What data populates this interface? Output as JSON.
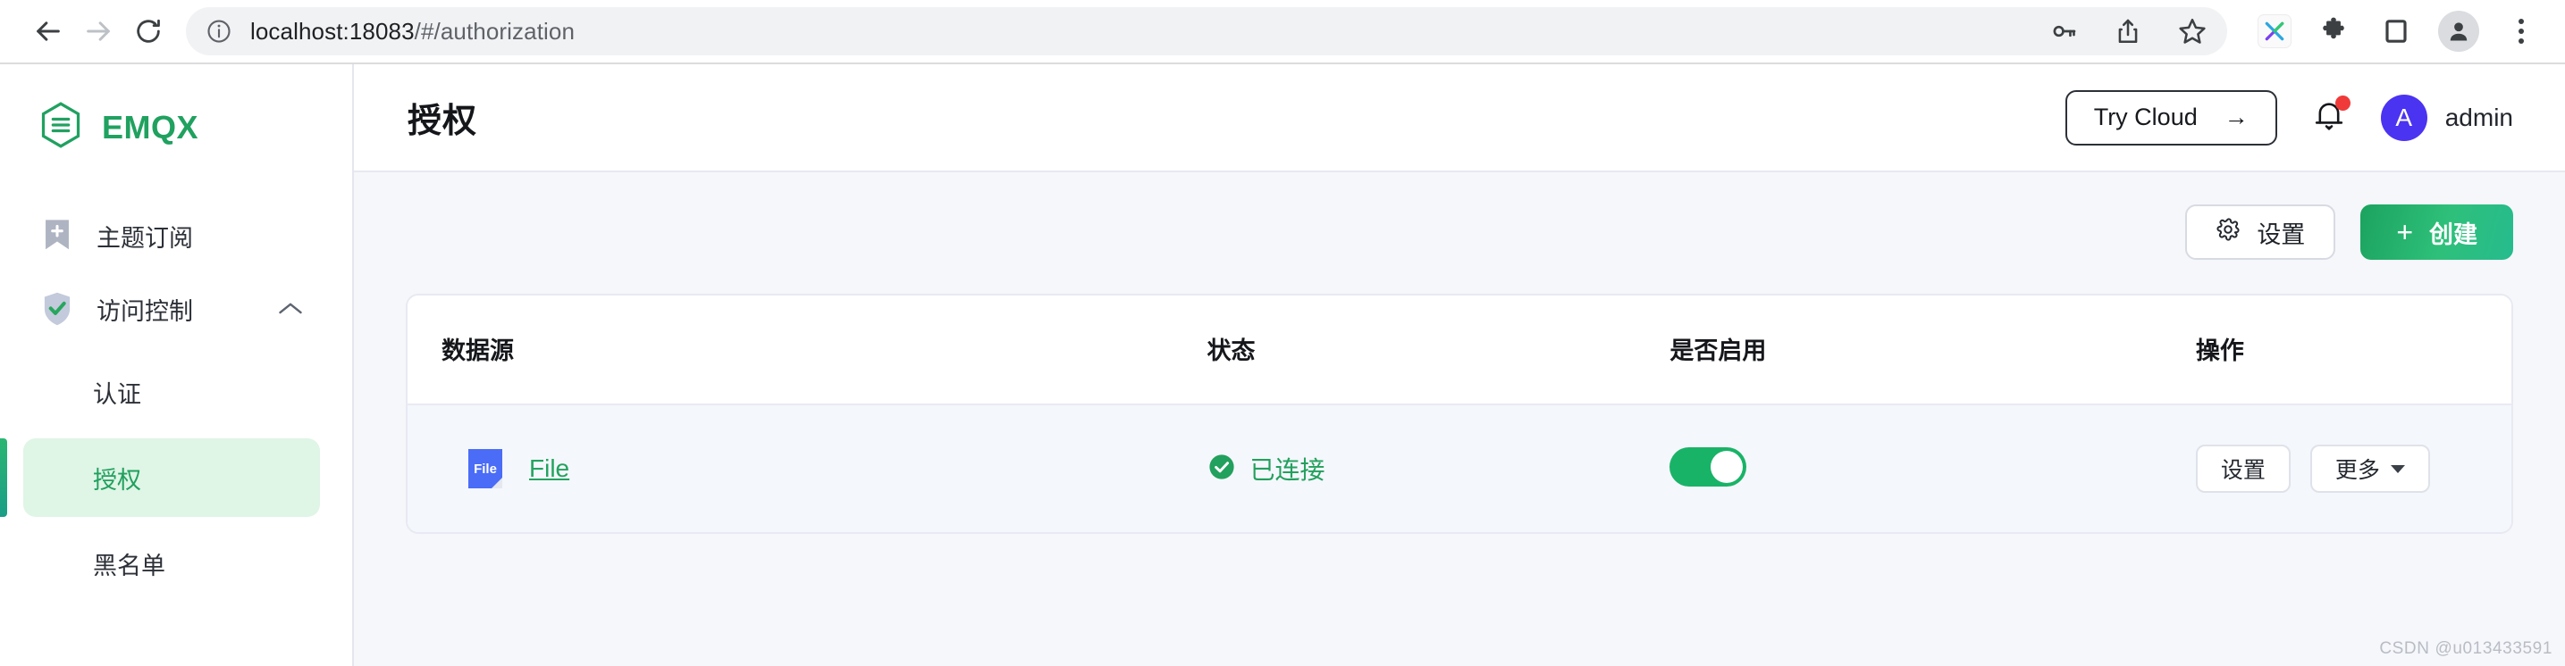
{
  "browser": {
    "url_prefix": "localhost:18083",
    "url_suffix": "/#/authorization",
    "back_icon": "back-arrow-icon",
    "forward_icon": "forward-arrow-icon",
    "reload_icon": "reload-icon",
    "info_icon": "site-info-icon",
    "key_icon": "password-key-icon",
    "share_icon": "share-icon",
    "bookmark_icon": "star-bookmark-icon",
    "extension_x_label": "X",
    "puzzle_icon": "extensions-puzzle-icon",
    "sidepanel_icon": "side-panel-icon",
    "profile_icon": "browser-profile-icon",
    "menu_icon": "three-dot-menu-icon"
  },
  "sidebar": {
    "brand": "EMQX",
    "brand_icon": "emqx-hexagon-logo",
    "items": [
      {
        "label": "主题订阅",
        "icon": "bookmark-plus-icon",
        "active": false,
        "expandable": false
      },
      {
        "label": "访问控制",
        "icon": "shield-check-icon",
        "active": false,
        "expandable": true,
        "caret": "chevron-up-icon"
      }
    ],
    "sub_items": [
      {
        "label": "认证",
        "active": false
      },
      {
        "label": "授权",
        "active": true
      },
      {
        "label": "黑名单",
        "active": false
      }
    ]
  },
  "header": {
    "title": "授权",
    "try_cloud": "Try Cloud",
    "try_cloud_arrow": "→",
    "bell_icon": "notification-bell-icon",
    "has_notification": true,
    "avatar_initial": "A",
    "user_name": "admin"
  },
  "toolbar": {
    "settings_label": "设置",
    "settings_icon": "gear-icon",
    "create_label": "创建",
    "create_icon": "plus-icon"
  },
  "table": {
    "columns": [
      "数据源",
      "状态",
      "是否启用",
      "操作"
    ],
    "rows": [
      {
        "source_icon": "file-document-icon",
        "source_icon_label": "File",
        "source": "File",
        "status": "已连接",
        "status_icon": "check-circle-icon",
        "enabled": true,
        "actions": [
          {
            "label": "设置",
            "has_caret": false
          },
          {
            "label": "更多",
            "has_caret": true
          }
        ]
      }
    ]
  },
  "watermark": "CSDN @u013433591",
  "colors": {
    "brand_green": "#20a160",
    "accent_green": "#19b368",
    "status_green": "#22a05d",
    "avatar_blue": "#4b33f2",
    "file_blue": "#4a6cf7",
    "notification_red": "#f03a3a",
    "content_bg": "#f5f7fa",
    "row_bg": "#f4f7fb",
    "active_nav_bg": "#dff5e6"
  }
}
